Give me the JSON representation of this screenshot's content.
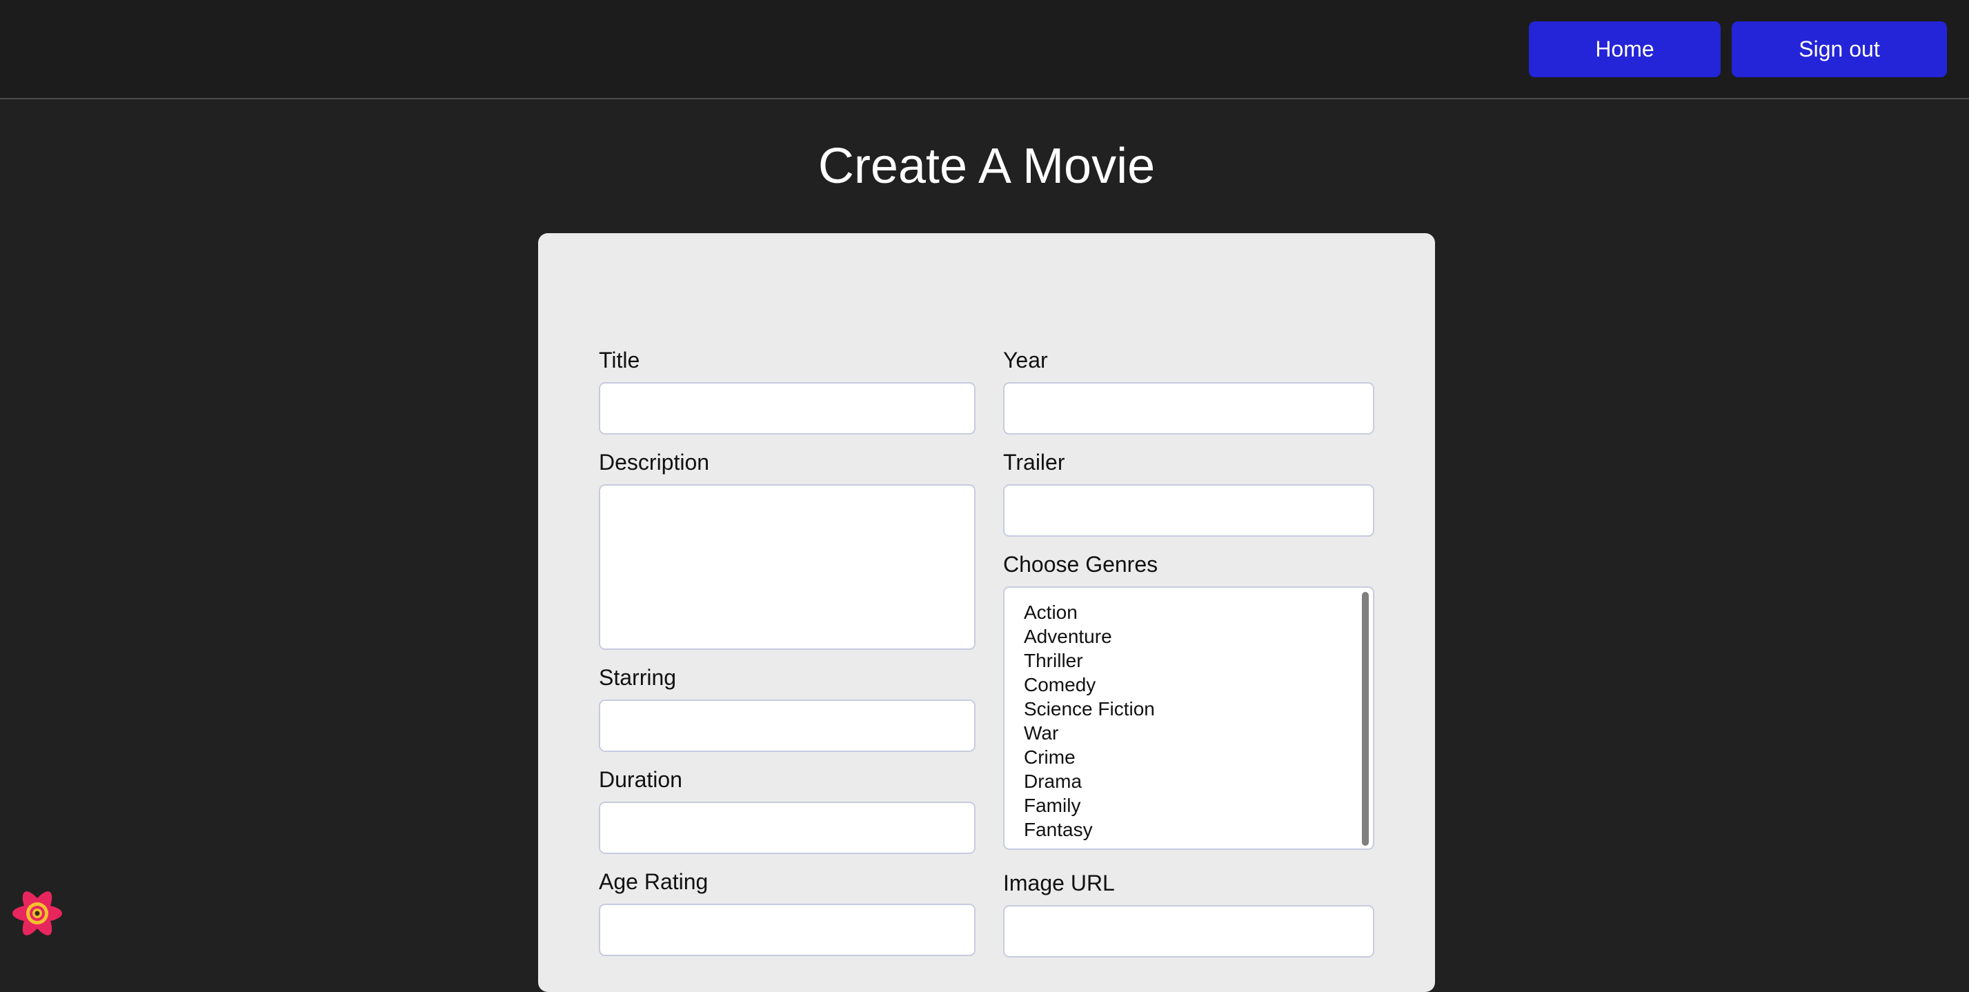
{
  "nav": {
    "home_label": "Home",
    "signout_label": "Sign out"
  },
  "page": {
    "title": "Create A Movie"
  },
  "form": {
    "title_label": "Title",
    "title_value": "",
    "year_label": "Year",
    "year_value": "",
    "description_label": "Description",
    "description_value": "",
    "trailer_label": "Trailer",
    "trailer_value": "",
    "genres_label": "Choose Genres",
    "genres": [
      "Action",
      "Adventure",
      "Thriller",
      "Comedy",
      "Science Fiction",
      "War",
      "Crime",
      "Drama",
      "Family",
      "Fantasy"
    ],
    "starring_label": "Starring",
    "starring_value": "",
    "duration_label": "Duration",
    "duration_value": "",
    "age_rating_label": "Age Rating",
    "age_rating_value": "",
    "image_url_label": "Image URL",
    "image_url_value": ""
  },
  "colors": {
    "background": "#212121",
    "topbar": "#1c1c1c",
    "button": "#2424d8",
    "card": "#ebebeb",
    "react_logo": "#e8265e"
  },
  "icons": {
    "devtools": "react-devtools-icon"
  }
}
